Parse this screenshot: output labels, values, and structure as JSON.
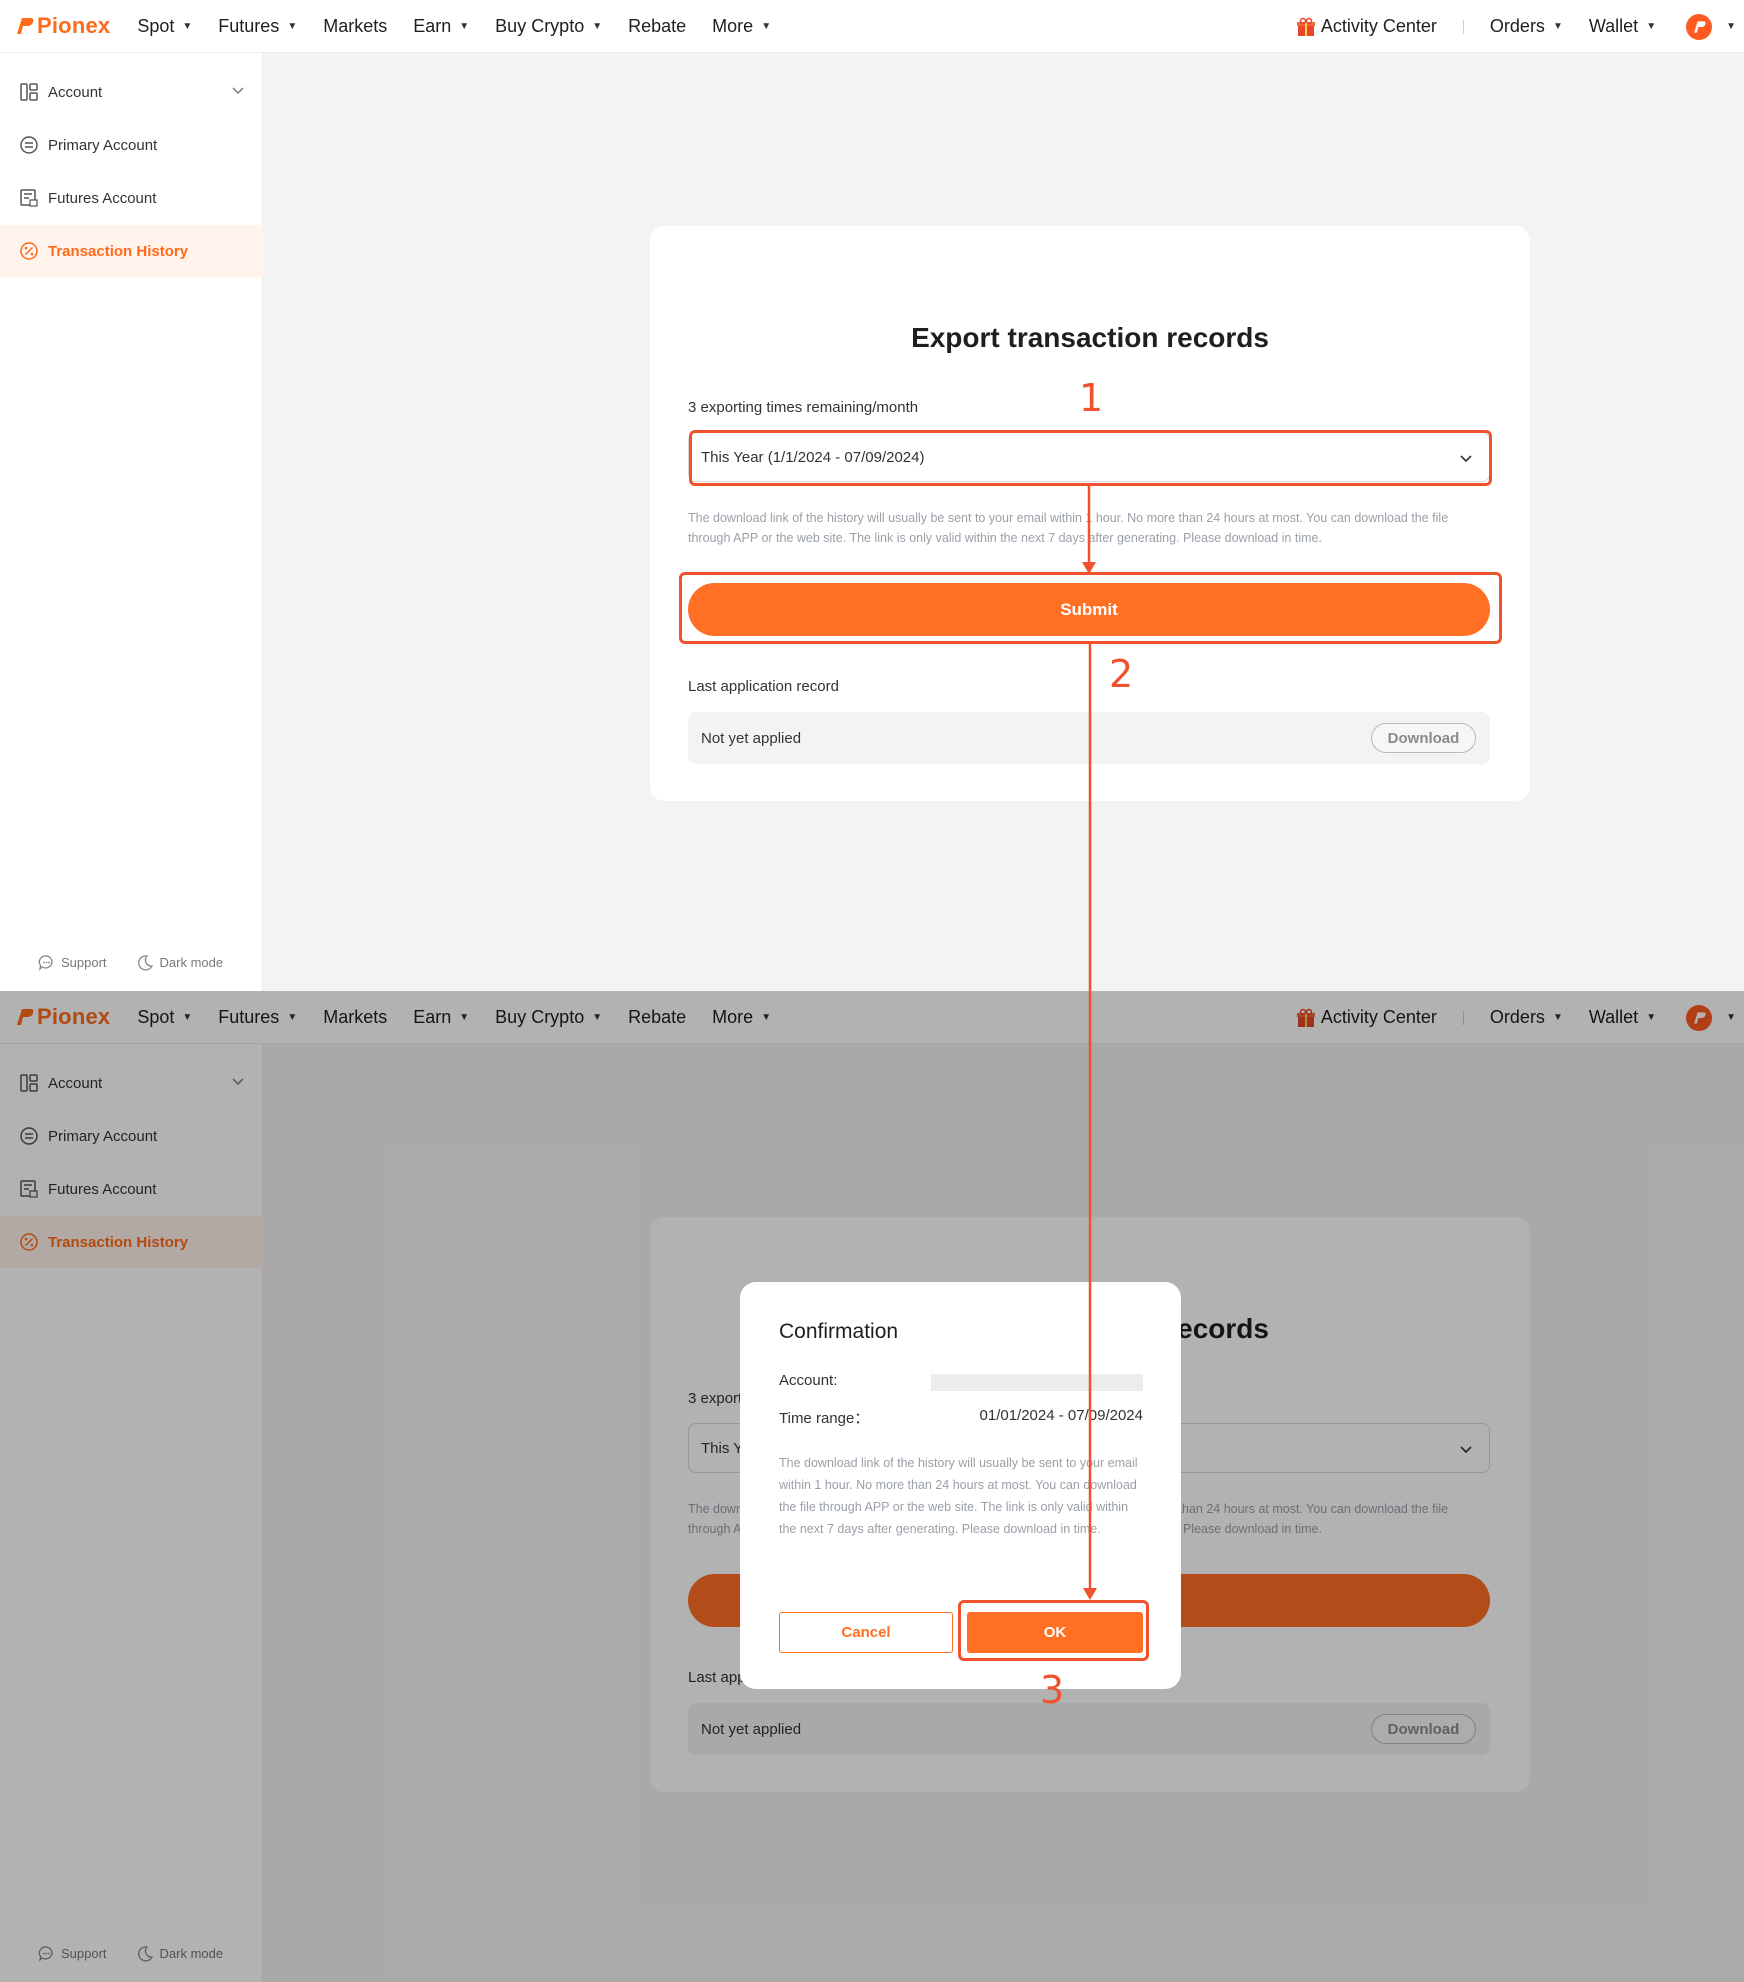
{
  "nav": {
    "brand": "Pionex",
    "items": [
      "Spot",
      "Futures",
      "Markets",
      "Earn",
      "Buy Crypto",
      "Rebate",
      "More"
    ],
    "items_with_caret": [
      true,
      true,
      false,
      true,
      true,
      false,
      true
    ],
    "activity_center": "Activity Center",
    "orders": "Orders",
    "wallet": "Wallet"
  },
  "sidebar": {
    "items": [
      {
        "label": "Account",
        "icon": "account-grid-icon"
      },
      {
        "label": "Primary Account",
        "icon": "primary-account-icon"
      },
      {
        "label": "Futures Account",
        "icon": "futures-account-icon"
      },
      {
        "label": "Transaction History",
        "icon": "transaction-history-icon"
      }
    ],
    "support": "Support",
    "dark_mode": "Dark mode"
  },
  "export": {
    "title": "Export transaction records",
    "remaining": "3 exporting times remaining/month",
    "range_selected": "This Year (1/1/2024 - 07/09/2024)",
    "hint": "The download link of the history will usually be sent to your email within 1 hour. No more than 24 hours at most. You can download the file through APP or the web site. The link is only valid within the next 7 days after generating. Please download in time.",
    "submit": "Submit",
    "last_record_label": "Last application record",
    "last_record_value": "Not yet applied",
    "download": "Download"
  },
  "modal": {
    "title": "Confirmation",
    "account_label": "Account:",
    "time_range_label": "Time range：",
    "time_range_value": "01/01/2024 - 07/09/2024",
    "hint": "The download link of the history will usually be sent to your email within 1 hour. No more than 24 hours at most. You can download the file through APP or the web site. The link is only valid within the next 7 days after generating. Please download in time.",
    "cancel": "Cancel",
    "ok": "OK"
  },
  "annotations": {
    "step1": "1",
    "step2": "2",
    "step3": "3"
  },
  "colors": {
    "accent": "#ff6f24",
    "annotation": "#f0522d"
  }
}
